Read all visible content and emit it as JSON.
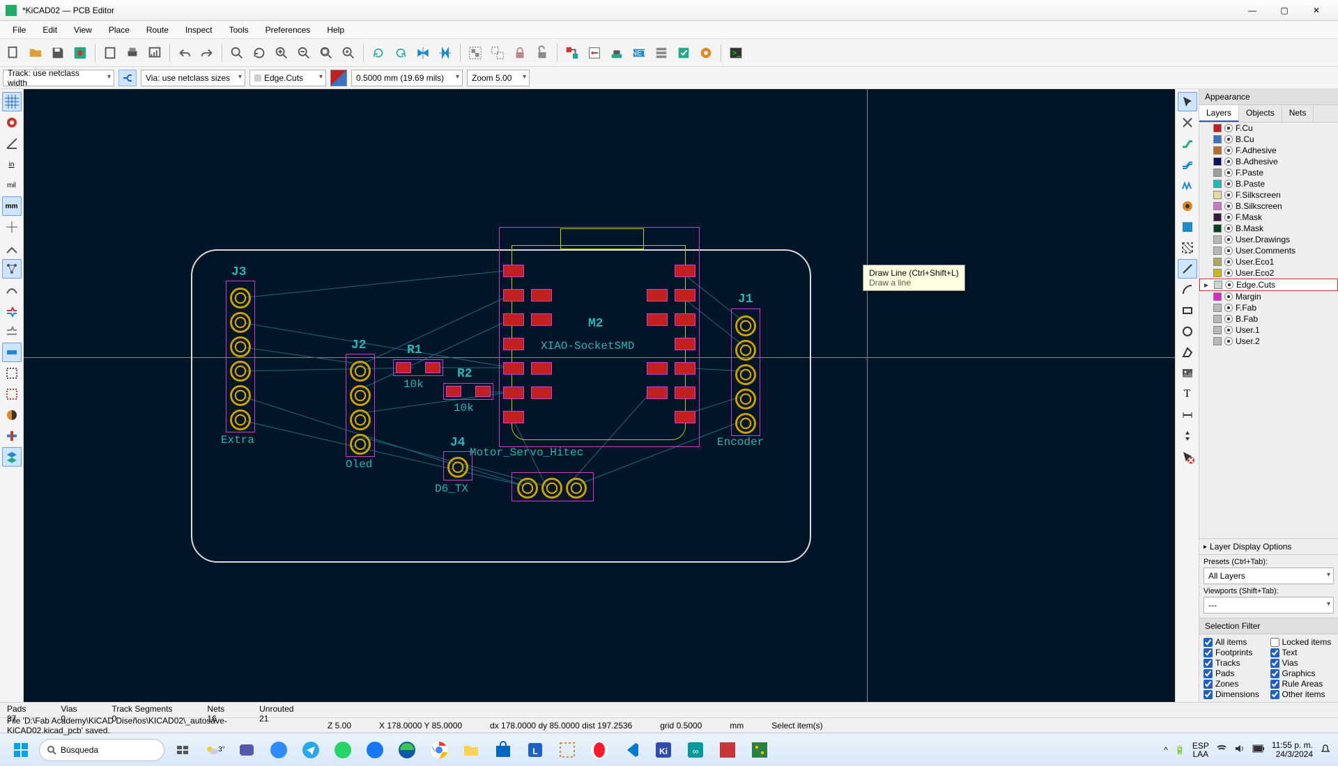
{
  "window": {
    "title": "*KiCAD02 — PCB Editor"
  },
  "menus": [
    "File",
    "Edit",
    "View",
    "Place",
    "Route",
    "Inspect",
    "Tools",
    "Preferences",
    "Help"
  ],
  "toolbar2": {
    "track": "Track: use netclass width",
    "via": "Via: use netclass sizes",
    "layer": "Edge.Cuts",
    "width": "0.5000 mm (19.69 mils)",
    "zoom": "Zoom 5.00"
  },
  "leftbar": {
    "mm_label": "mm",
    "in_label": "in",
    "mil_label": "mil"
  },
  "appearance": {
    "header": "Appearance",
    "tabs": [
      "Layers",
      "Objects",
      "Nets"
    ],
    "layers": [
      {
        "name": "F.Cu",
        "color": "#c02020"
      },
      {
        "name": "B.Cu",
        "color": "#3874c4"
      },
      {
        "name": "F.Adhesive",
        "color": "#b07028"
      },
      {
        "name": "B.Adhesive",
        "color": "#101060"
      },
      {
        "name": "F.Paste",
        "color": "#a0a0a0"
      },
      {
        "name": "B.Paste",
        "color": "#20b8b8"
      },
      {
        "name": "F.Silkscreen",
        "color": "#e8d8a0"
      },
      {
        "name": "B.Silkscreen",
        "color": "#c878c8"
      },
      {
        "name": "F.Mask",
        "color": "#3a1a3a"
      },
      {
        "name": "B.Mask",
        "color": "#084028"
      },
      {
        "name": "User.Drawings",
        "color": "#b8b8b8"
      },
      {
        "name": "User.Comments",
        "color": "#b8b8b8"
      },
      {
        "name": "User.Eco1",
        "color": "#b0a860"
      },
      {
        "name": "User.Eco2",
        "color": "#c8b820"
      },
      {
        "name": "Edge.Cuts",
        "color": "#d0d0d0",
        "selected": true
      },
      {
        "name": "Margin",
        "color": "#d828c8"
      },
      {
        "name": "F.Fab",
        "color": "#b8b8b8"
      },
      {
        "name": "B.Fab",
        "color": "#b8b8b8"
      },
      {
        "name": "User.1",
        "color": "#b8b8b8"
      },
      {
        "name": "User.2",
        "color": "#b8b8b8"
      }
    ],
    "layer_display": "Layer Display Options",
    "presets_label": "Presets (Ctrl+Tab):",
    "presets_value": "All Layers",
    "viewports_label": "Viewports (Shift+Tab):",
    "viewports_value": "---"
  },
  "selection_filter": {
    "header": "Selection Filter",
    "items": [
      {
        "label": "All items",
        "checked": true
      },
      {
        "label": "Locked items",
        "checked": false
      },
      {
        "label": "Footprints",
        "checked": true
      },
      {
        "label": "Text",
        "checked": true
      },
      {
        "label": "Tracks",
        "checked": true
      },
      {
        "label": "Vias",
        "checked": true
      },
      {
        "label": "Pads",
        "checked": true
      },
      {
        "label": "Graphics",
        "checked": true
      },
      {
        "label": "Zones",
        "checked": true
      },
      {
        "label": "Rule Areas",
        "checked": true
      },
      {
        "label": "Dimensions",
        "checked": true
      },
      {
        "label": "Other items",
        "checked": true
      }
    ]
  },
  "tooltip": {
    "title": "Draw Line  (Ctrl+Shift+L)",
    "sub": "Draw a line"
  },
  "status1": {
    "pads_l": "Pads",
    "pads_v": "37",
    "vias_l": "Vias",
    "vias_v": "0",
    "tracks_l": "Track Segments",
    "tracks_v": "0",
    "nets_l": "Nets",
    "nets_v": "16",
    "unrouted_l": "Unrouted",
    "unrouted_v": "21"
  },
  "status2": {
    "msg": "File 'D:\\Fab Academy\\KiCAD Diseños\\KICAD02\\_autosave-KiCAD02.kicad_pcb' saved.",
    "z": "Z 5.00",
    "xy": "X 178.0000  Y 85.0000",
    "dxy": "dx 178.0000  dy 85.0000  dist 197.2536",
    "grid": "grid 0.5000",
    "units": "mm",
    "hint": "Select item(s)"
  },
  "taskbar": {
    "search": "Búsqueda",
    "lang1": "ESP",
    "lang2": "LAA",
    "time": "11:55 p. m.",
    "date": "24/3/2024",
    "weather": "3°"
  },
  "pcb": {
    "refs": {
      "J1": "J1",
      "J2": "J2",
      "J3": "J3",
      "J4": "J4",
      "R1": "R1",
      "R2": "R2",
      "M2": "M2",
      "R1v": "10k",
      "R2v": "10k",
      "Extra": "Extra",
      "Oled": "Oled",
      "Encoder": "Encoder",
      "D6TX": "D6_TX",
      "Motor": "Motor_Servo_Hitec",
      "Xiao": "XIAO-SocketSMD"
    }
  }
}
